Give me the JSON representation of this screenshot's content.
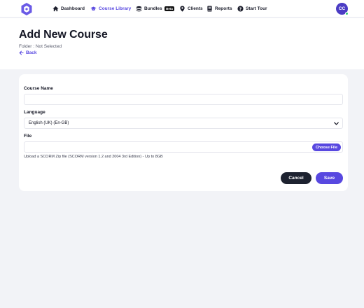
{
  "nav": {
    "items": [
      {
        "label": "Dashboard",
        "icon": "home-icon"
      },
      {
        "label": "Course Library",
        "icon": "graduation-cap-icon",
        "active": true
      },
      {
        "label": "Bundles",
        "icon": "layers-icon",
        "badge": "Beta"
      },
      {
        "label": "Clients",
        "icon": "map-pin-icon"
      },
      {
        "label": "Reports",
        "icon": "report-book-icon"
      },
      {
        "label": "Start Tour",
        "icon": "question-circle-icon"
      }
    ],
    "avatar_initials": "CC"
  },
  "header": {
    "title": "Add New Course",
    "folder": "Folder : Not Selected",
    "back_label": "Back"
  },
  "form": {
    "course_name_label": "Course Name",
    "course_name_value": "",
    "language_label": "Language",
    "language_value": "English (UK) (En-GB)",
    "file_label": "File",
    "choose_file_label": "Choose File",
    "file_help": "Upload a SCORM Zip file (SCORM version 1.2 and 2004 3rd Edition) - Up to 8GB",
    "cancel_label": "Cancel",
    "save_label": "Save"
  },
  "colors": {
    "accent": "#5848e0",
    "dark_button": "#1d2230",
    "page_background": "#f2f3f7",
    "avatar": "#4b3cc4",
    "online_status": "#2ecb71"
  }
}
